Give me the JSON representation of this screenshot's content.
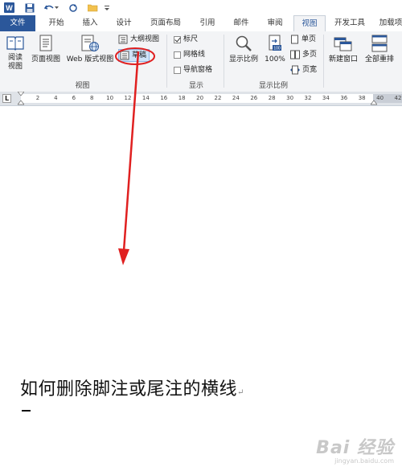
{
  "quick_access": {
    "word_icon": "word-app-icon",
    "save_icon": "save-icon",
    "undo_icon": "undo-icon",
    "redo_icon": "redo-icon",
    "open_icon": "open-folder-icon",
    "customize_icon": "customize-qat-icon"
  },
  "tabs": {
    "file": "文件",
    "home": "开始",
    "insert": "插入",
    "design": "设计",
    "layout": "页面布局",
    "references": "引用",
    "mailings": "邮件",
    "review": "审阅",
    "view": "视图",
    "developer": "开发工具",
    "addins": "加载项"
  },
  "ribbon": {
    "views": {
      "read_mode": "阅读\n视图",
      "print_layout": "页面视图",
      "web_layout": "Web 版式视图",
      "outline": "大纲视图",
      "draft": "草稿",
      "group_label": "视图"
    },
    "show": {
      "ruler": "标尺",
      "ruler_checked": true,
      "gridlines": "网格线",
      "gridlines_checked": false,
      "nav_pane": "导航窗格",
      "nav_pane_checked": false,
      "group_label": "显示"
    },
    "zoom": {
      "zoom": "显示比例",
      "hundred": "100%",
      "one_page": "单页",
      "multi_page": "多页",
      "page_width": "页宽",
      "group_label": "显示比例"
    },
    "window": {
      "new_window": "新建窗口",
      "arrange_all": "全部重排"
    }
  },
  "ruler": {
    "tab_selector": "L",
    "ticks": [
      "2",
      "4",
      "6",
      "8",
      "10",
      "12",
      "14",
      "16",
      "18",
      "20",
      "22",
      "24",
      "26",
      "28",
      "30",
      "32",
      "34",
      "36",
      "38",
      "40",
      "42"
    ]
  },
  "document": {
    "text": "如何删除脚注或尾注的横线",
    "para_mark": "↵"
  },
  "watermark": {
    "brand": "Bai 经验",
    "url": "jingyan.baidu.com"
  },
  "colors": {
    "file_tab": "#2b579a",
    "annotation_red": "#e02020",
    "ribbon_bg": "#f3f4f6"
  }
}
